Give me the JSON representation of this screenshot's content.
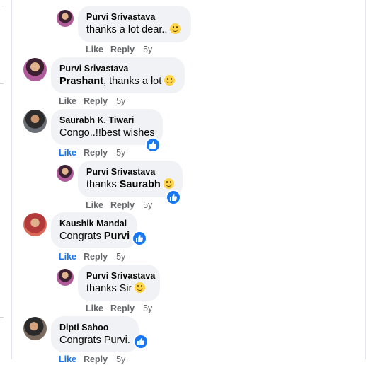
{
  "actions": {
    "like": "Like",
    "reply": "Reply"
  },
  "comments": [
    {
      "author": "Purvi Srivastava",
      "pre": "thanks a lot dear..",
      "bold": "",
      "post": "",
      "emoji": "smile-emoji",
      "time": "5y",
      "liked": false,
      "reaction": false
    },
    {
      "author": "Purvi Srivastava",
      "pre": "",
      "bold": "Prashant",
      "post": ", thanks a lot",
      "emoji": "smile-emoji",
      "time": "5y",
      "liked": false,
      "reaction": false
    },
    {
      "author": "Saurabh K. Tiwari",
      "pre": "Congo..!!best wishes",
      "bold": "",
      "post": "",
      "emoji": "",
      "time": "5y",
      "liked": true,
      "reaction": "like-reaction-icon"
    },
    {
      "author": "Purvi Srivastava",
      "pre": "thanks ",
      "bold": "Saurabh",
      "post": "",
      "emoji": "smile-emoji",
      "time": "5y",
      "liked": false,
      "reaction": "like-reaction-icon"
    },
    {
      "author": "Kaushik Mandal",
      "pre": "Congrats ",
      "bold": "Purvi",
      "post": "",
      "emoji": "",
      "time": "5y",
      "liked": true,
      "reaction": "like-reaction-icon"
    },
    {
      "author": "Purvi Srivastava",
      "pre": "thanks Sir",
      "bold": "",
      "post": "",
      "emoji": "smile-emoji",
      "time": "5y",
      "liked": false,
      "reaction": false
    },
    {
      "author": "Dipti Sahoo",
      "pre": "Congrats Purvi.",
      "bold": "",
      "post": "",
      "emoji": "",
      "time": "5y",
      "liked": true,
      "reaction": "like-reaction-icon"
    }
  ],
  "colors": {
    "bubble": "#f0f2f5",
    "like_blue": "#1877f2",
    "meta_gray": "#65676b"
  }
}
